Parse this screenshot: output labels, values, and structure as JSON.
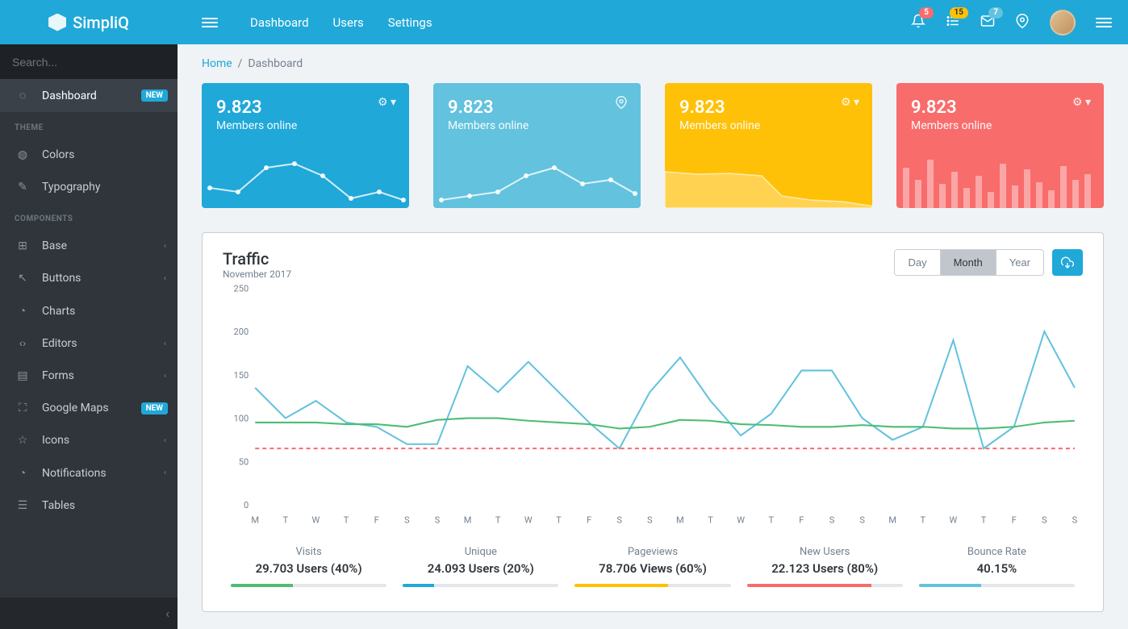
{
  "brand": "SimpliQ",
  "nav": {
    "items": [
      "Dashboard",
      "Users",
      "Settings"
    ]
  },
  "header": {
    "badges": {
      "bell": "5",
      "list": "15",
      "mail": "7"
    }
  },
  "search": {
    "placeholder": "Search..."
  },
  "sidebar": {
    "dashboard": "Dashboard",
    "badge_new": "NEW",
    "title_theme": "THEME",
    "colors": "Colors",
    "typography": "Typography",
    "title_components": "COMPONENTS",
    "base": "Base",
    "buttons": "Buttons",
    "charts": "Charts",
    "editors": "Editors",
    "forms": "Forms",
    "googlemaps": "Google Maps",
    "icons": "Icons",
    "notifications": "Notifications",
    "tables": "Tables"
  },
  "breadcrumb": {
    "home": "Home",
    "current": "Dashboard"
  },
  "widgets": [
    {
      "value": "9.823",
      "label": "Members online"
    },
    {
      "value": "9.823",
      "label": "Members online"
    },
    {
      "value": "9.823",
      "label": "Members online"
    },
    {
      "value": "9.823",
      "label": "Members online"
    }
  ],
  "traffic": {
    "title": "Traffic",
    "subtitle": "November 2017",
    "range": {
      "day": "Day",
      "month": "Month",
      "year": "Year",
      "active": "month"
    },
    "stats": [
      {
        "label": "Visits",
        "value": "29.703 Users (40%)",
        "pct": 40,
        "color": "#4dbd74"
      },
      {
        "label": "Unique",
        "value": "24.093 Users (20%)",
        "pct": 20,
        "color": "#20a8d8"
      },
      {
        "label": "Pageviews",
        "value": "78.706 Views (60%)",
        "pct": 60,
        "color": "#ffc107"
      },
      {
        "label": "New Users",
        "value": "22.123 Users (80%)",
        "pct": 80,
        "color": "#f86c6b"
      },
      {
        "label": "Bounce Rate",
        "value": "40.15%",
        "pct": 40,
        "color": "#63c2de"
      }
    ]
  },
  "chart_data": {
    "type": "line",
    "categories": [
      "M",
      "T",
      "W",
      "T",
      "F",
      "S",
      "S",
      "M",
      "T",
      "W",
      "T",
      "F",
      "S",
      "S",
      "M",
      "T",
      "W",
      "T",
      "F",
      "S",
      "S",
      "M",
      "T",
      "W",
      "T",
      "F",
      "S",
      "S"
    ],
    "ylim": [
      0,
      250
    ],
    "yticks": [
      0,
      50,
      100,
      150,
      200,
      250
    ],
    "series": [
      {
        "name": "line1",
        "color": "#63c2de",
        "values": [
          135,
          100,
          120,
          95,
          90,
          70,
          70,
          160,
          130,
          165,
          130,
          95,
          65,
          130,
          170,
          120,
          80,
          105,
          155,
          155,
          100,
          75,
          90,
          190,
          65,
          90,
          200,
          135
        ]
      },
      {
        "name": "line2",
        "color": "#4dbd74",
        "values": [
          95,
          95,
          95,
          93,
          93,
          90,
          98,
          100,
          100,
          97,
          95,
          93,
          88,
          90,
          98,
          97,
          93,
          92,
          90,
          90,
          92,
          90,
          90,
          88,
          88,
          90,
          95,
          97
        ]
      },
      {
        "name": "baseline",
        "color": "#f86c6b",
        "dashed": true,
        "values": [
          65,
          65,
          65,
          65,
          65,
          65,
          65,
          65,
          65,
          65,
          65,
          65,
          65,
          65,
          65,
          65,
          65,
          65,
          65,
          65,
          65,
          65,
          65,
          65,
          65,
          65,
          65,
          65
        ]
      }
    ]
  }
}
